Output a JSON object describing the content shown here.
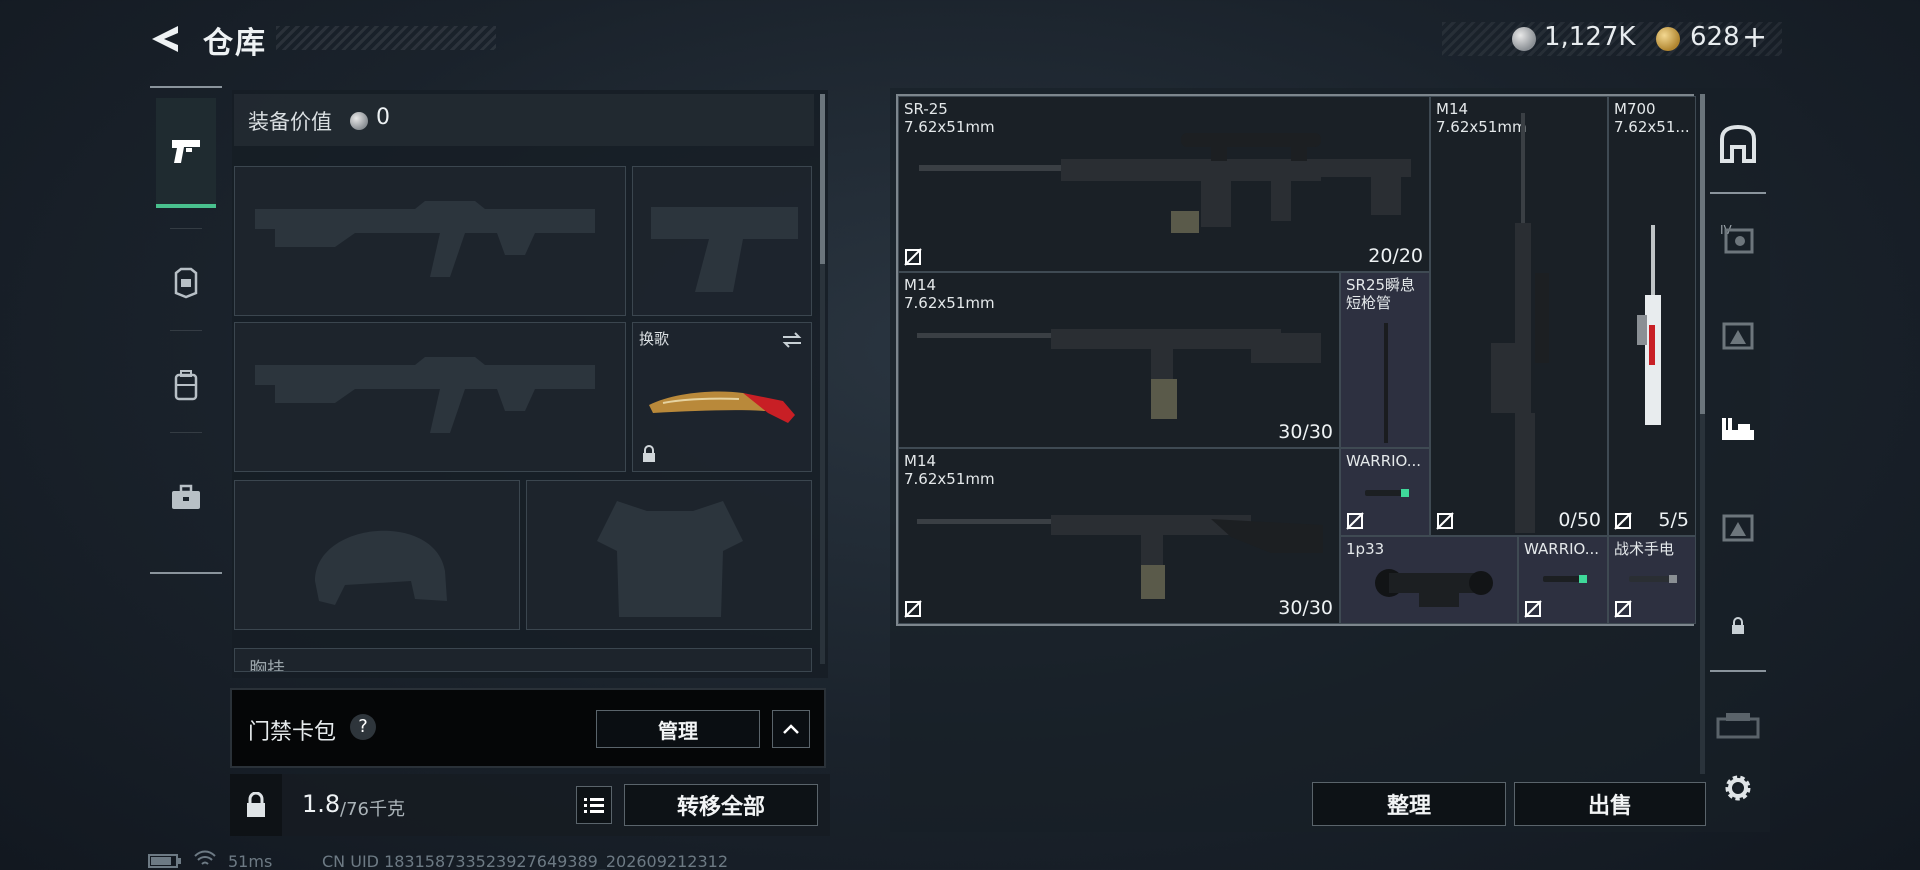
{
  "header": {
    "title": "仓库",
    "currency": [
      {
        "icon": "silver-coin-icon",
        "value": "1,127K"
      },
      {
        "icon": "gold-coin-icon",
        "value": "628"
      }
    ],
    "add_label": "+"
  },
  "loadout": {
    "equip_value_label": "装备价值",
    "equip_value": "0",
    "melee_label": "换歌",
    "chest_label": "胸挂"
  },
  "keycard": {
    "label": "门禁卡包",
    "help": "?",
    "manage_label": "管理"
  },
  "capacity": {
    "current": "1.8",
    "max": "/76千克",
    "transfer_all_label": "转移全部"
  },
  "grid": {
    "items": [
      {
        "name": "SR-25\n7.62x51mm",
        "count": "20/20"
      },
      {
        "name": "M14\n7.62x51mm",
        "count": ""
      },
      {
        "name": "M700\n7.62x51...",
        "count": ""
      },
      {
        "name": "M14\n7.62x51mm",
        "count": "30/30"
      },
      {
        "name": "SR25瞬息\n短枪管",
        "count": ""
      },
      {
        "name": "M14\n7.62x51mm",
        "count": "30/30"
      },
      {
        "name": "WARRIO...",
        "count": ""
      },
      {
        "name": "1p33",
        "count": ""
      },
      {
        "name": "WARRIO...",
        "count": ""
      },
      {
        "name": "战术手电",
        "count": ""
      },
      {
        "name": "",
        "count": "0/50"
      },
      {
        "name": "",
        "count": "5/5"
      }
    ]
  },
  "actions": {
    "sort_label": "整理",
    "sell_label": "出售"
  },
  "footer": {
    "ping": "51ms",
    "uid": "CN UID 1831587335239276493​89_202609212312"
  }
}
